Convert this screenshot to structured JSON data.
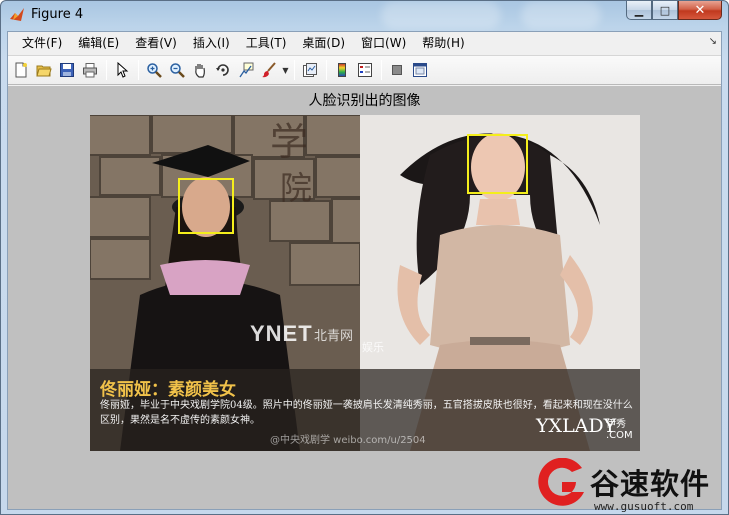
{
  "window": {
    "title": "Figure 4",
    "caption": {
      "minimize": "▁",
      "maximize": "□",
      "close": "✕"
    }
  },
  "menubar": {
    "items": [
      {
        "id": "file",
        "label": "文件(F)"
      },
      {
        "id": "edit",
        "label": "编辑(E)"
      },
      {
        "id": "view",
        "label": "查看(V)"
      },
      {
        "id": "insert",
        "label": "插入(I)"
      },
      {
        "id": "tools",
        "label": "工具(T)"
      },
      {
        "id": "desktop",
        "label": "桌面(D)"
      },
      {
        "id": "window",
        "label": "窗口(W)"
      },
      {
        "id": "help",
        "label": "帮助(H)"
      }
    ],
    "dock_arrow": "↘"
  },
  "toolbar": {
    "buttons": [
      "new-figure-icon",
      "open-folder-icon",
      "save-icon",
      "print-icon",
      "pointer-icon",
      "zoom-in-icon",
      "zoom-out-icon",
      "pan-hand-icon",
      "rotate-3d-icon",
      "data-cursor-icon",
      "brush-icon",
      "link-plot-icon",
      "colorbar-icon",
      "legend-icon",
      "hide-plot-tools-icon",
      "show-plot-tools-icon"
    ]
  },
  "figure": {
    "title": "人脸识别出的图像",
    "banner_title": "佟丽娅：素颜美女",
    "banner_body": "佟丽娅，毕业于中央戏剧学院04级。照片中的佟丽娅一袭披肩长发清纯秀丽，五官搭拔皮肤也很好，看起来和现在没什么区别，果然是名不虚传的素颜女神。",
    "ynet": "YNET",
    "ynet_sub": "北青网",
    "ynet_tag": "娱乐",
    "weibo": "@中央戏剧学 weibo.com/u/2504",
    "yxlady": "YXLADY",
    "yxlady_cn": "伊秀",
    "yxlady_com": ".COM",
    "box_color": "#f4ee1c"
  },
  "watermark": {
    "text": "谷速软件",
    "url": "www.gusuoft.com",
    "logo_color": "#e02020"
  }
}
